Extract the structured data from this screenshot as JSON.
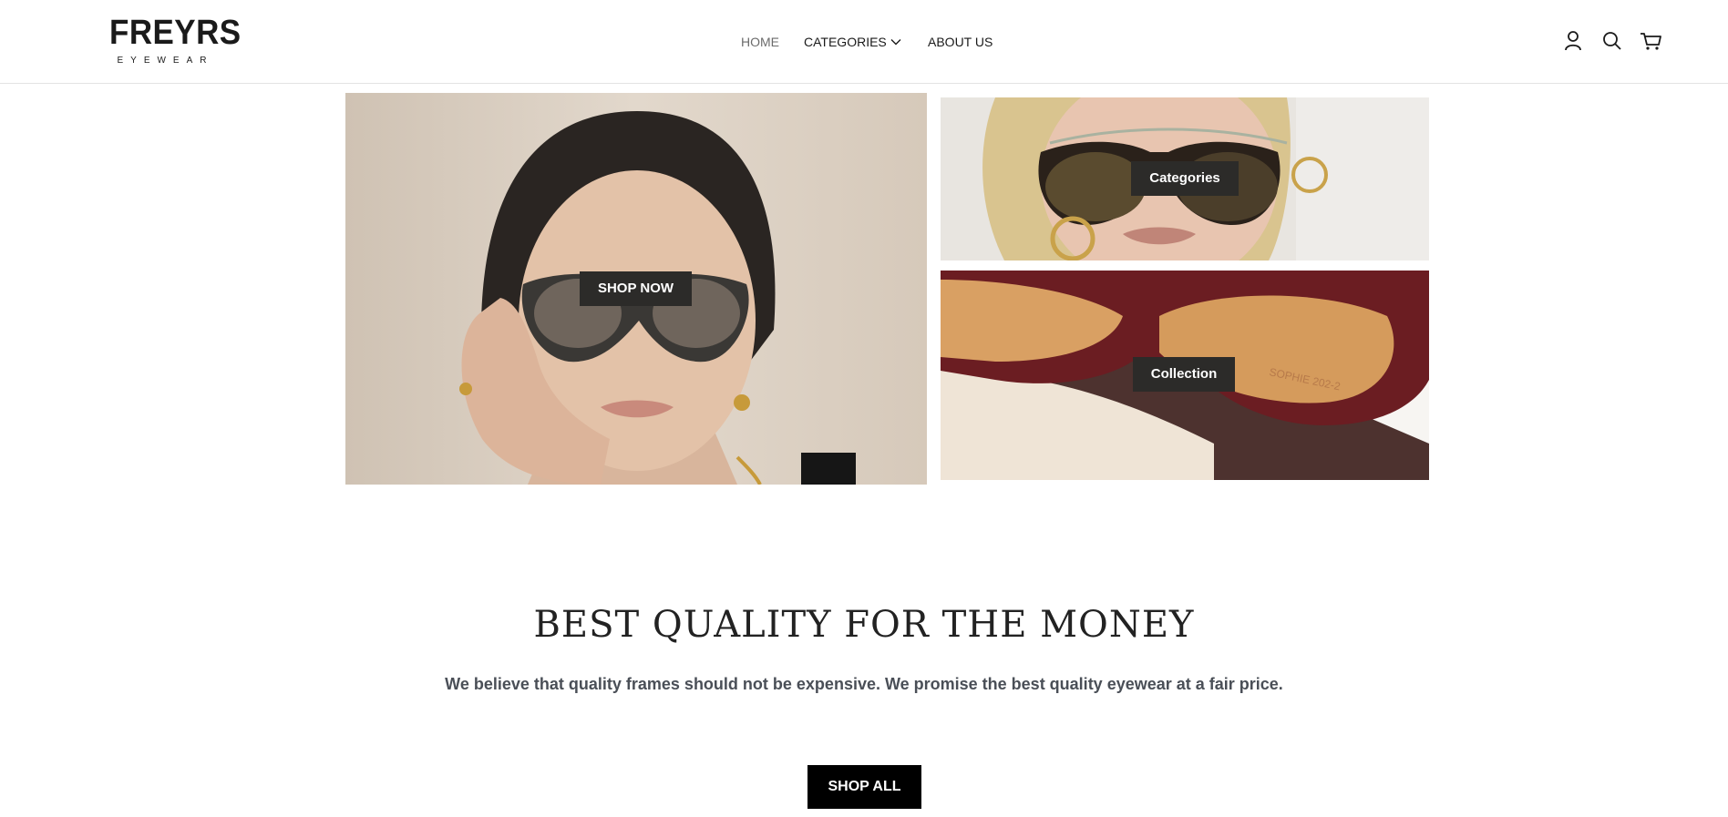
{
  "brand": {
    "name": "FREYRS",
    "tagline": "EYEWEAR"
  },
  "nav": {
    "items": [
      {
        "label": "HOME"
      },
      {
        "label": "CATEGORIES"
      },
      {
        "label": "ABOUT US"
      }
    ]
  },
  "header_icons": [
    "account-icon",
    "search-icon",
    "cart-icon"
  ],
  "hero": {
    "main_button": "SHOP NOW",
    "top_button": "Categories",
    "bottom_button": "Collection",
    "lens_text": "SOPHIE 202-2"
  },
  "quality": {
    "title": "BEST QUALITY FOR THE MONEY",
    "description": "We believe that quality frames should not be expensive. We promise the best quality eyewear at a fair price.",
    "button": "SHOP ALL"
  },
  "colors": {
    "button_dark": "#2c2b29",
    "shop_all_bg": "#000000",
    "nav_active": "#6b6b6b"
  }
}
